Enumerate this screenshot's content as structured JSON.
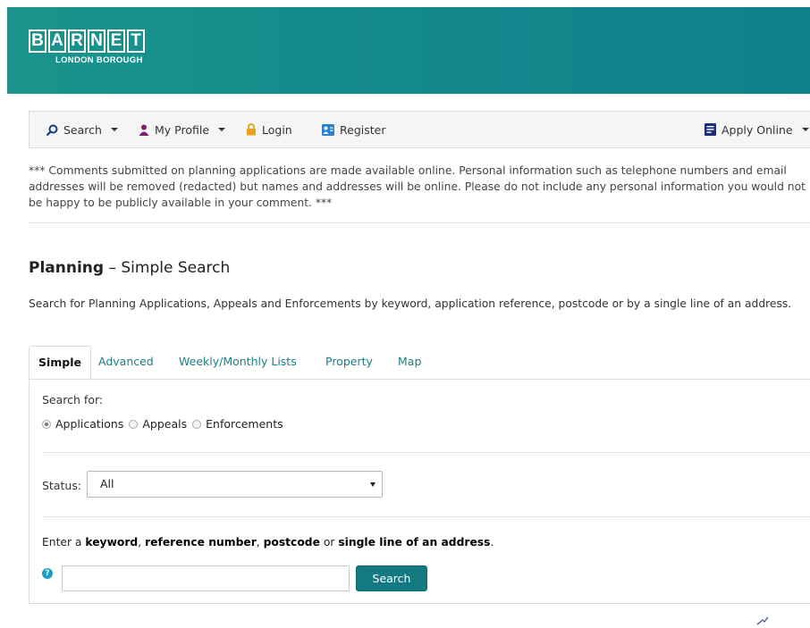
{
  "brand": {
    "letters": [
      "B",
      "A",
      "R",
      "N",
      "E",
      "T"
    ],
    "subtitle": "LONDON BOROUGH",
    "header_color": "#138a8c"
  },
  "nav": {
    "search": "Search",
    "profile": "My Profile",
    "login": "Login",
    "register": "Register",
    "apply": "Apply Online"
  },
  "notice": "*** Comments submitted on planning applications are made available online. Personal information such as telephone numbers and email addresses will be removed (redacted) but names and addresses will be online. Please do not include any personal information you would not be happy to be publicly available in your comment. ***",
  "page": {
    "title_bold": "Planning",
    "title_rest": " – Simple Search",
    "description": "Search for Planning Applications, Appeals and Enforcements by keyword, application reference, postcode or by a single line of an address."
  },
  "tabs": [
    "Simple",
    "Advanced",
    "Weekly/Monthly Lists",
    "Property",
    "Map"
  ],
  "form": {
    "search_for_label": "Search for:",
    "radios": [
      "Applications",
      "Appeals",
      "Enforcements"
    ],
    "selected_radio": "Applications",
    "status_label": "Status:",
    "status_value": "All",
    "hint": {
      "p1": "Enter a ",
      "b1": "keyword",
      "p2": ", ",
      "b2": "reference number",
      "p3": ", ",
      "b3": "postcode",
      "p4": " or ",
      "b4": "single line of an address",
      "p5": "."
    },
    "search_value": "",
    "search_button": "Search"
  },
  "colors": {
    "accent": "#137a83",
    "link": "#1b7f86",
    "help": "#1aa0c8"
  }
}
